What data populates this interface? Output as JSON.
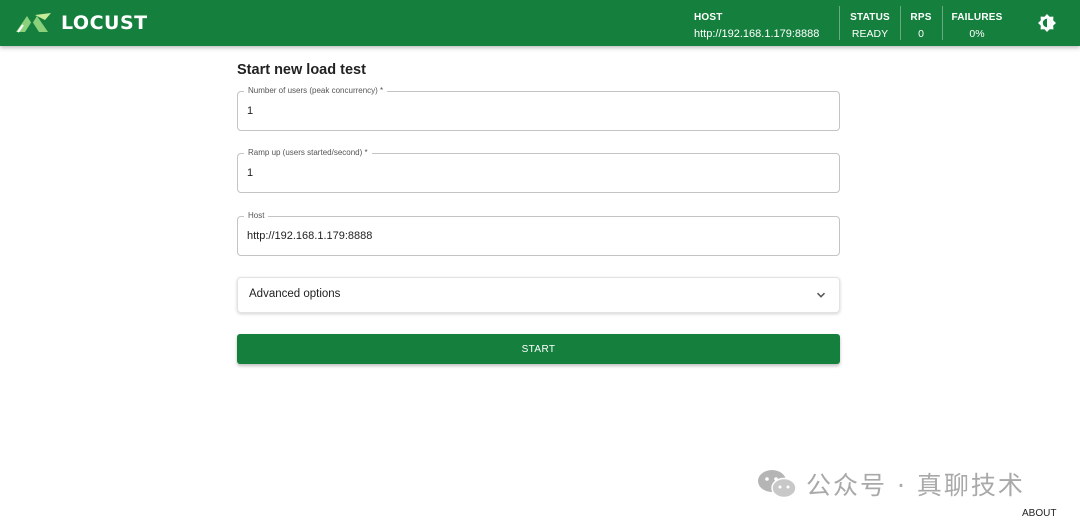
{
  "header": {
    "logo_text": "LOCUST",
    "host_label": "HOST",
    "host_value": "http://192.168.1.179:8888",
    "status_label": "STATUS",
    "status_value": "READY",
    "rps_label": "RPS",
    "rps_value": "0",
    "failures_label": "FAILURES",
    "failures_value": "0%",
    "theme_icon": "brightness-icon"
  },
  "form": {
    "title": "Start new load test",
    "users_label": "Number of users (peak concurrency) *",
    "users_value": "1",
    "ramp_label": "Ramp up (users started/second) *",
    "ramp_value": "1",
    "host_label": "Host",
    "host_value": "http://192.168.1.179:8888",
    "advanced_label": "Advanced options",
    "start_label": "START"
  },
  "footer": {
    "about_label": "ABOUT"
  },
  "watermark": {
    "text": "公众号 · 真聊技术"
  },
  "colors": {
    "brand_green": "#15803d"
  }
}
